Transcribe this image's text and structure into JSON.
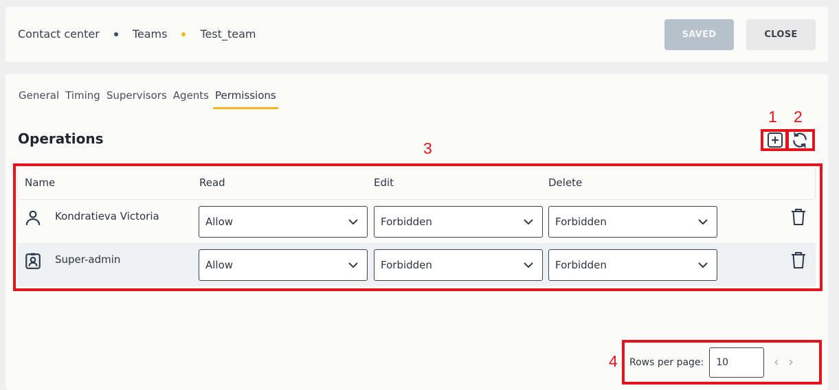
{
  "breadcrumb": {
    "items": [
      "Contact center",
      "Teams",
      "Test_team"
    ],
    "dot_colors": [
      "#3b4d63",
      "#f4b81e"
    ]
  },
  "header": {
    "saved_label": "SAVED",
    "close_label": "CLOSE"
  },
  "tabs": [
    "General",
    "Timing",
    "Supervisors",
    "Agents",
    "Permissions"
  ],
  "active_tab": "Permissions",
  "section": {
    "title": "Operations"
  },
  "table": {
    "headers": [
      "Name",
      "Read",
      "Edit",
      "Delete"
    ],
    "rows": [
      {
        "name": "Kondratieva Victoria",
        "type_icon": "user-icon",
        "read": "Allow",
        "edit": "Forbidden",
        "delete": "Forbidden"
      },
      {
        "name": "Super-admin",
        "type_icon": "role-badge-icon",
        "read": "Allow",
        "edit": "Forbidden",
        "delete": "Forbidden"
      }
    ]
  },
  "pagination": {
    "rows_per_page_label": "Rows per page:",
    "rows_per_page_value": "10"
  },
  "annotations": [
    "1",
    "2",
    "3",
    "4"
  ],
  "colors": {
    "accent": "#f4b81e",
    "annotation": "#e4141c",
    "saved_bg": "#b7c1c9"
  }
}
